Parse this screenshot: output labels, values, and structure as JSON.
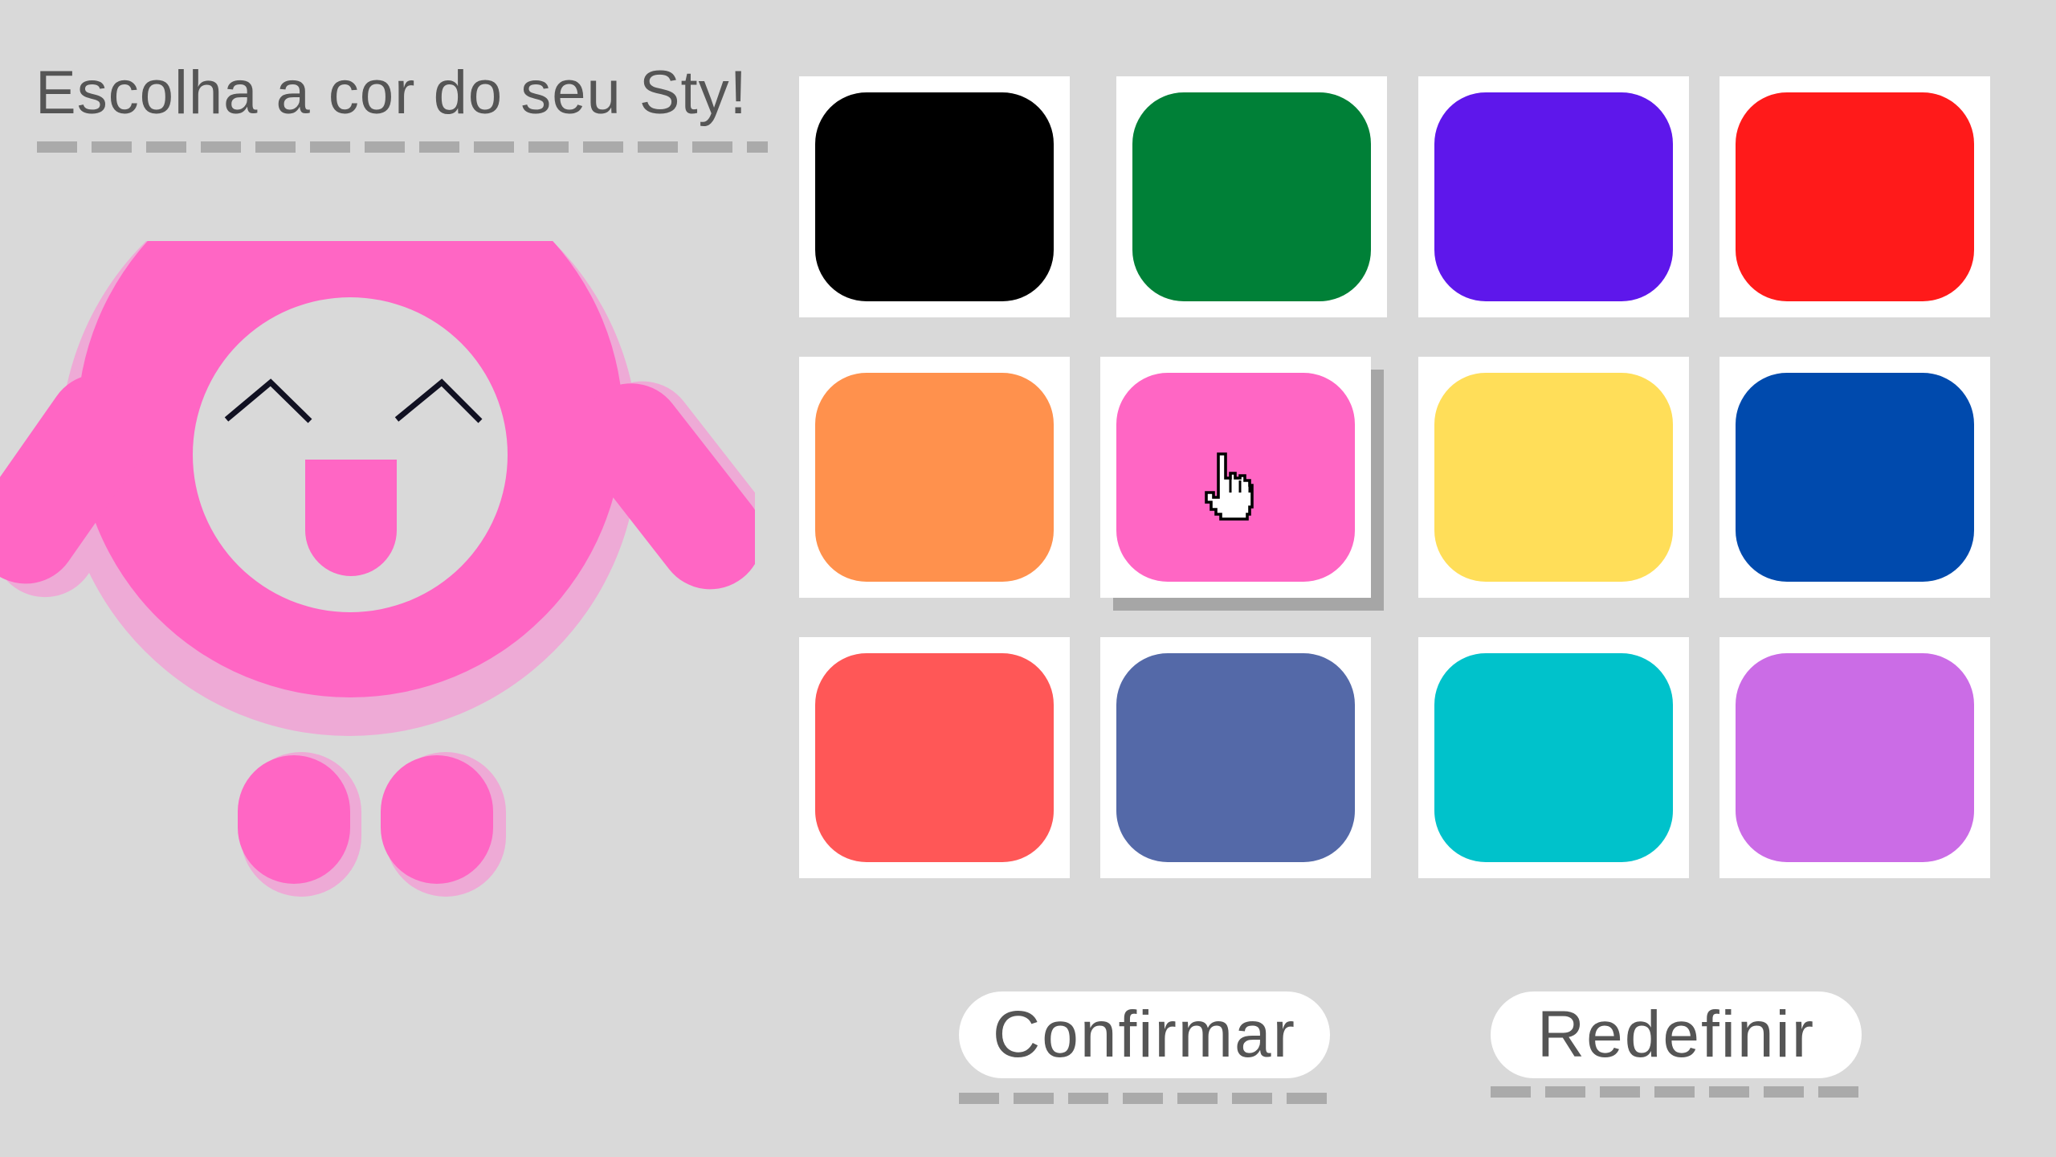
{
  "title": "Escolha a cor do seu Sty!",
  "character": {
    "name": "sty",
    "color": "#ff66c4",
    "shadow_color": "#eeaad6",
    "face_color": "#d9d9d9",
    "eye_color": "#111122"
  },
  "palette": {
    "selected_index": 5,
    "swatches": [
      {
        "name": "black",
        "color": "#000000"
      },
      {
        "name": "green",
        "color": "#008037"
      },
      {
        "name": "purple",
        "color": "#5e17eb"
      },
      {
        "name": "red",
        "color": "#ff1a1a"
      },
      {
        "name": "orange",
        "color": "#ff914d"
      },
      {
        "name": "pink",
        "color": "#ff66c4"
      },
      {
        "name": "yellow",
        "color": "#ffde59"
      },
      {
        "name": "blue",
        "color": "#004aad"
      },
      {
        "name": "coral",
        "color": "#ff5757"
      },
      {
        "name": "slate-blue",
        "color": "#5469a8"
      },
      {
        "name": "cyan",
        "color": "#00c2cb"
      },
      {
        "name": "lavender",
        "color": "#cb6ce6"
      }
    ]
  },
  "buttons": {
    "confirm_label": "Confirmar",
    "reset_label": "Redefinir"
  }
}
